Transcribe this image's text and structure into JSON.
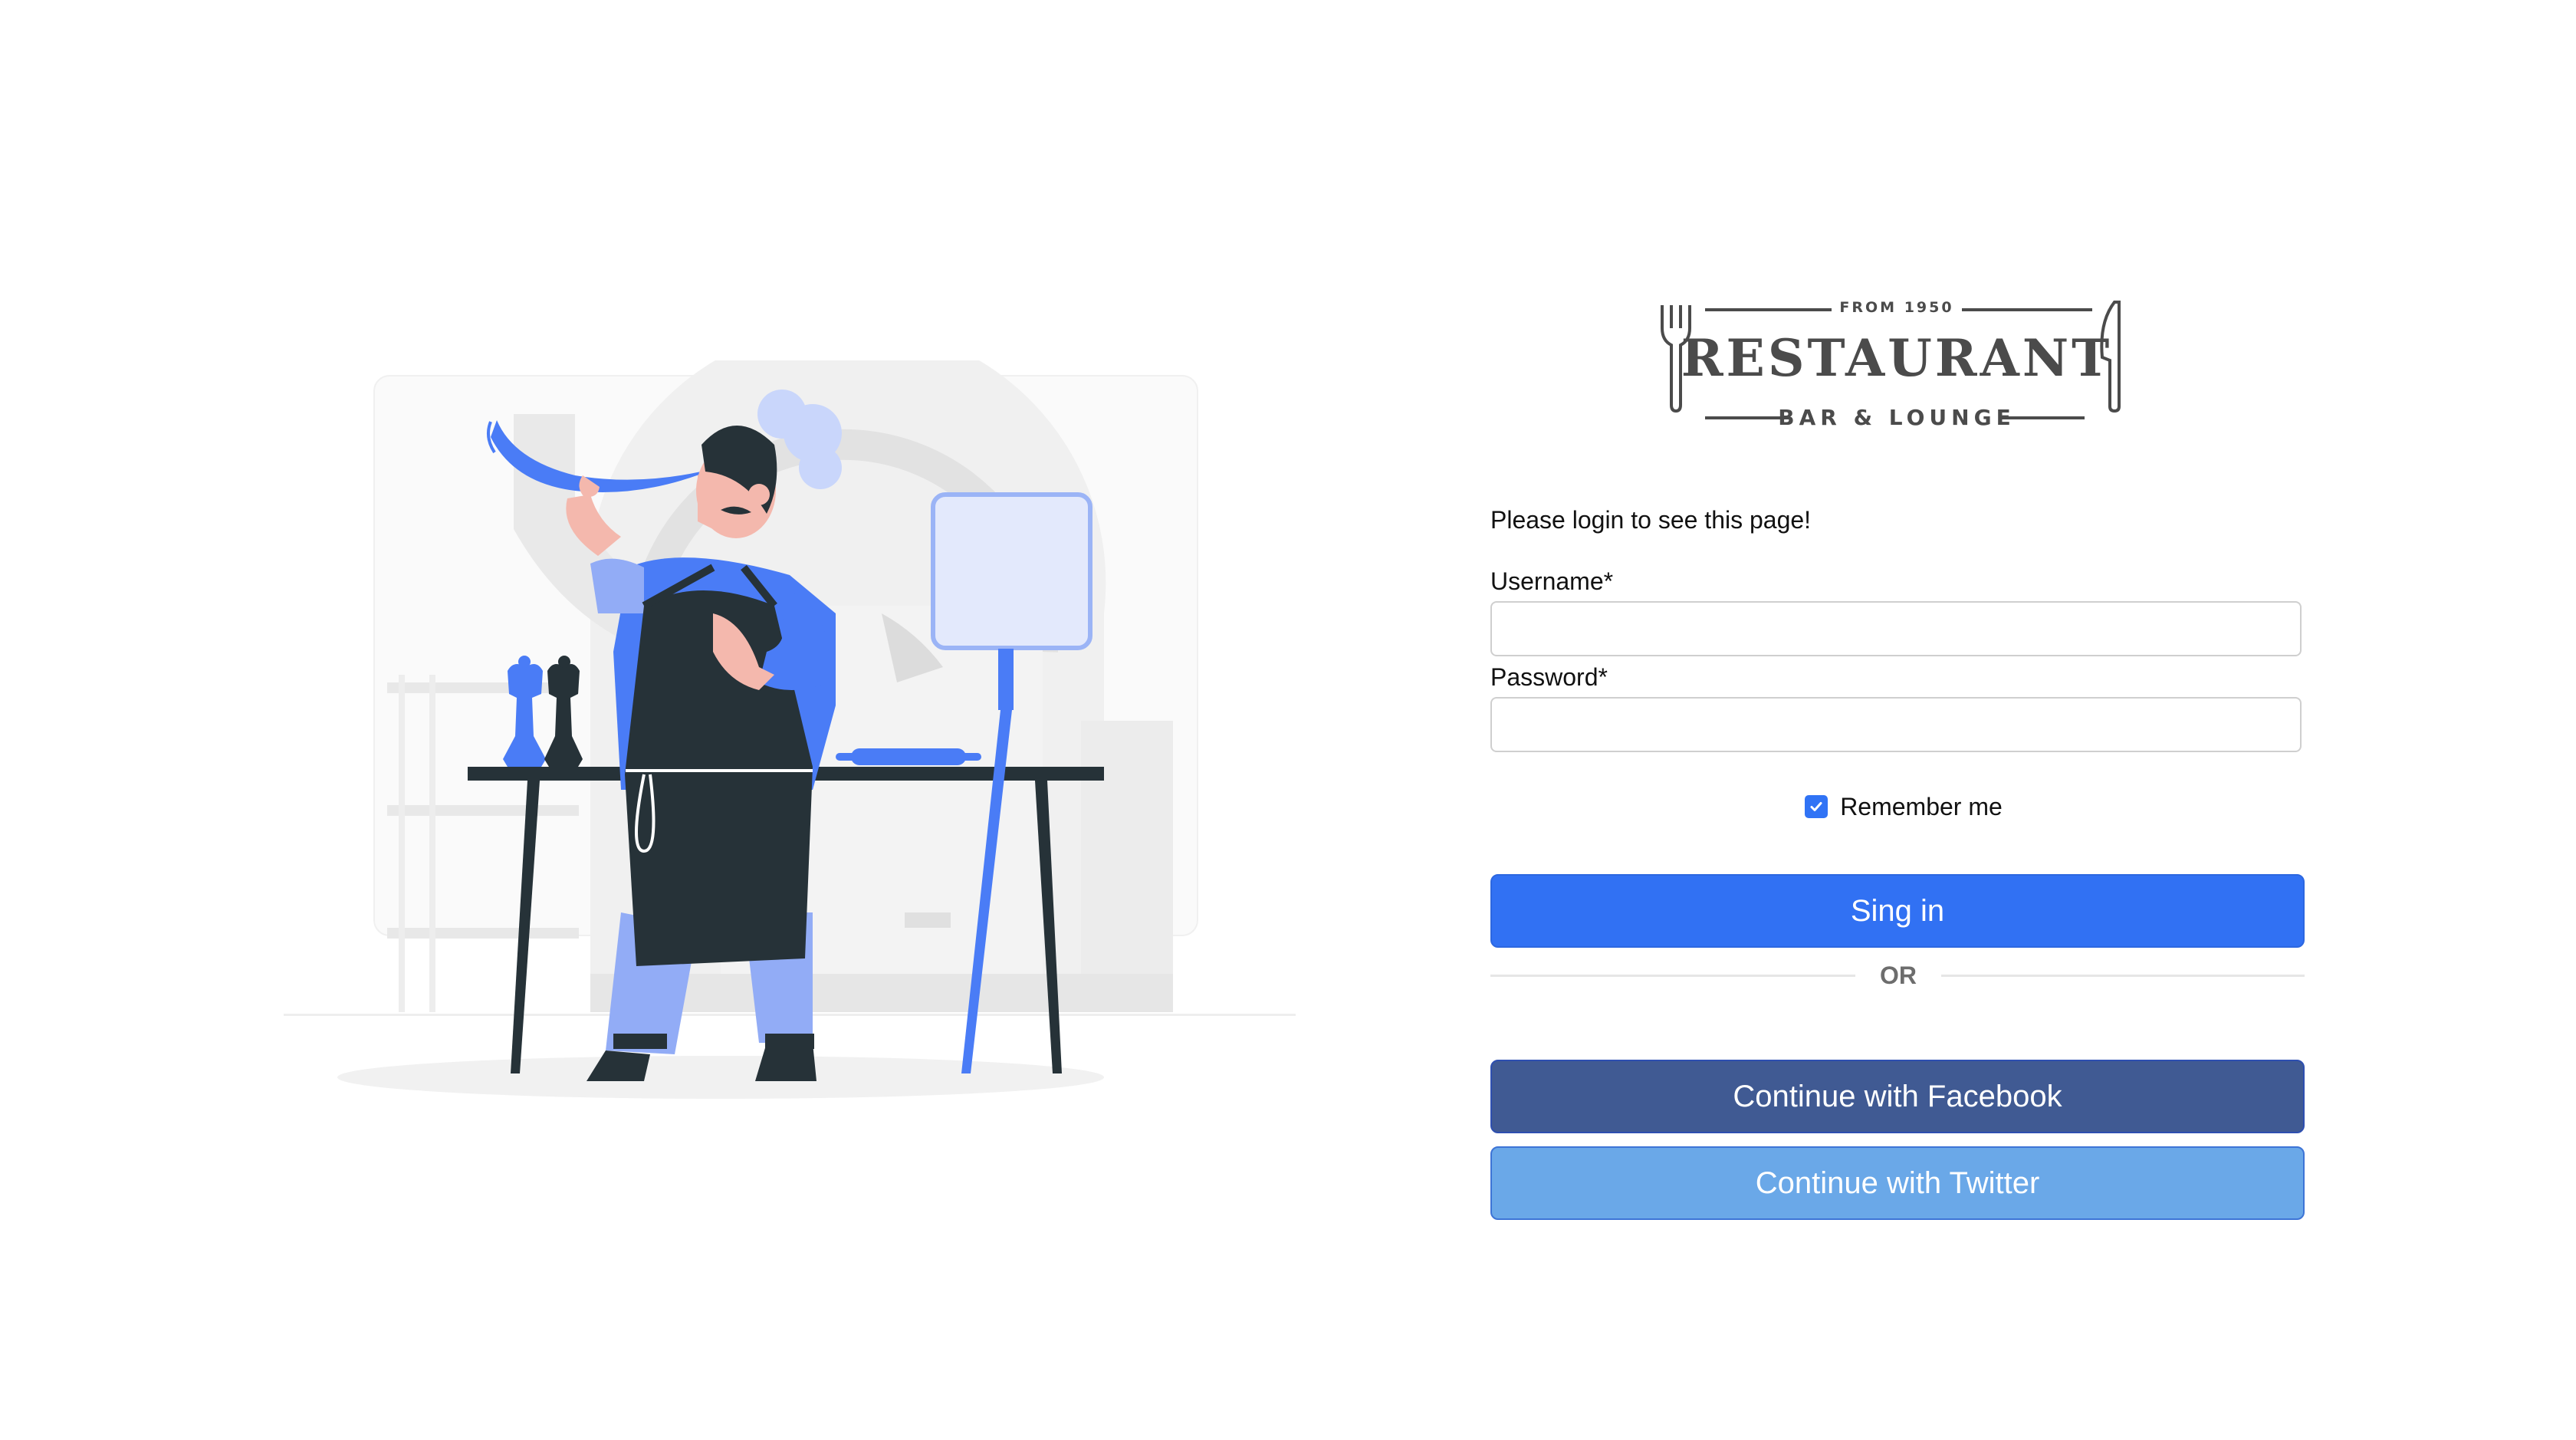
{
  "logo": {
    "from": "FROM 1950",
    "name": "RESTAURANT",
    "subtitle": "BAR & LOUNGE",
    "icons": [
      "fork-icon",
      "knife-icon"
    ]
  },
  "login": {
    "intro": "Please login to see this page!",
    "username_label": "Username*",
    "username_value": "",
    "password_label": "Password*",
    "password_value": "",
    "remember_label": "Remember me",
    "remember_checked": true,
    "signin_label": "Sing in",
    "or_label": "OR",
    "facebook_label": "Continue with Facebook",
    "twitter_label": "Continue with Twitter"
  },
  "colors": {
    "primary": "#3171f3",
    "facebook": "#405a93",
    "twitter": "#6aa8e8",
    "logo_gray": "#4b4b4b",
    "illustration_blue": "#4a7cf6",
    "illustration_dark": "#263238"
  }
}
